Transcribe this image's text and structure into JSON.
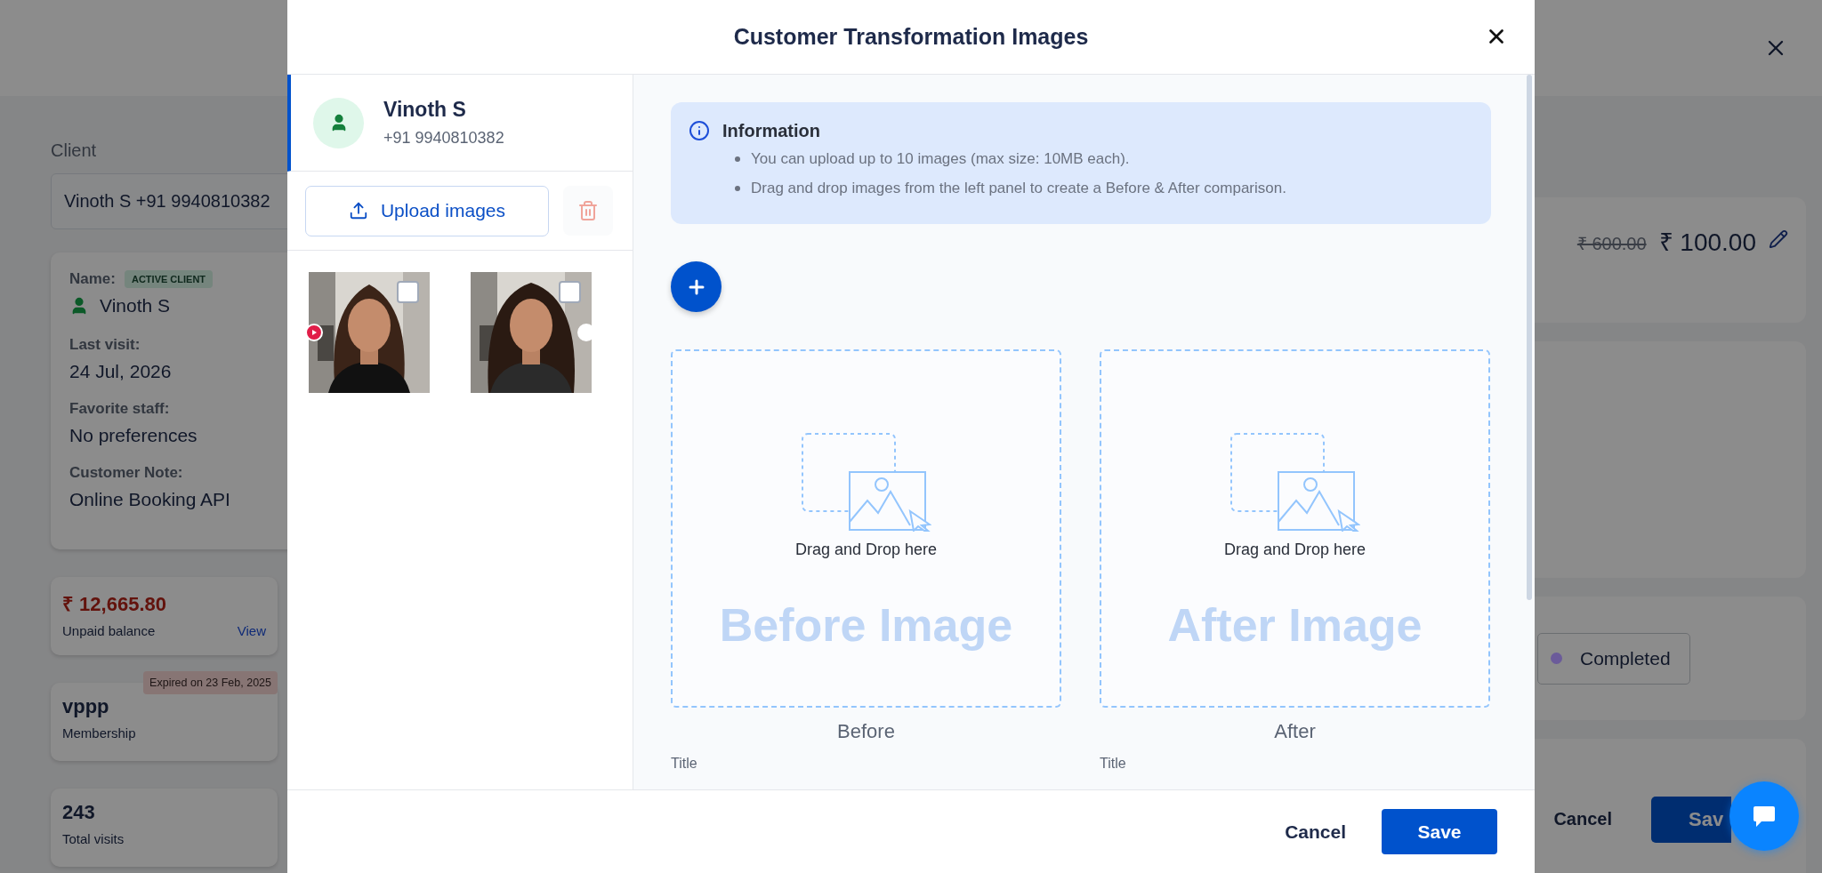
{
  "background": {
    "client_label": "Client",
    "client_value": "Vinoth S +91 9940810382",
    "client_card": {
      "name_label": "Name:",
      "badge": "ACTIVE CLIENT",
      "name": "Vinoth S",
      "fields": [
        {
          "label": "Last visit:",
          "value": "24 Jul, 2026"
        },
        {
          "label": "Favorite staff:",
          "value": "No preferences"
        },
        {
          "label": "Customer Note:",
          "value": "Online Booking API"
        }
      ]
    },
    "stats": [
      {
        "kind": "balance",
        "value": "₹ 12,665.80",
        "label": "Unpaid balance",
        "link": "View"
      },
      {
        "kind": "membership",
        "badge": "Expired on 23 Feb, 2025",
        "value": "vppp",
        "label": "Membership"
      },
      {
        "kind": "plain",
        "value": "243",
        "label": "Total visits"
      }
    ],
    "price": {
      "original": "₹ 600.00",
      "current": "₹ 100.00"
    },
    "status": {
      "label": "Completed",
      "color": "#6b5b9a"
    },
    "buttons": {
      "cancel": "Cancel",
      "save": "Sav"
    }
  },
  "modal": {
    "title": "Customer Transformation Images",
    "client": {
      "name": "Vinoth S",
      "phone": "+91 9940810382",
      "selected": true
    },
    "upload_button": "Upload images",
    "thumbnails": [
      {
        "kind": "picture",
        "checked": false,
        "left_marker": true,
        "right_marker": false
      },
      {
        "kind": "picture",
        "checked": false,
        "left_marker": false,
        "right_marker": true
      }
    ],
    "info": {
      "title": "Information",
      "items": [
        "You can upload up to 10 images (max size: 10MB each).",
        "Drag and drop images from the left panel to create a Before & After comparison."
      ]
    },
    "slots": [
      {
        "hint": "Drag and Drop here",
        "watermark": "Before Image",
        "label": "Before",
        "field_label": "Title"
      },
      {
        "hint": "Drag and Drop here",
        "watermark": "After Image",
        "label": "After",
        "field_label": "Title"
      }
    ],
    "footer": {
      "cancel": "Cancel",
      "save": "Save"
    }
  }
}
